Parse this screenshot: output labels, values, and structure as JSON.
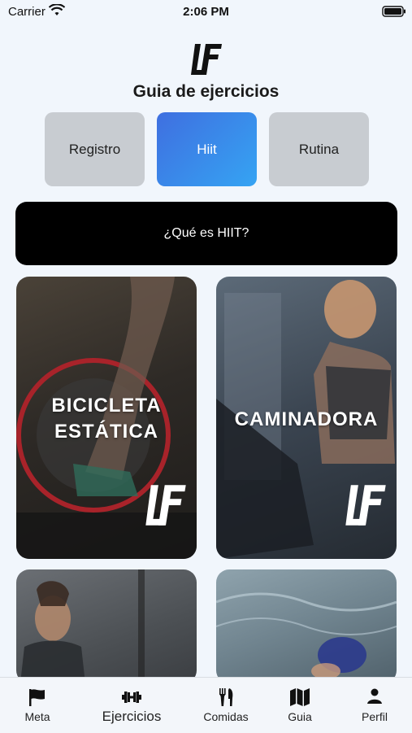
{
  "status": {
    "carrier": "Carrier",
    "time": "2:06 PM"
  },
  "header": {
    "title": "Guia de ejercicios"
  },
  "segments": [
    {
      "label": "Registro"
    },
    {
      "label": "Hiit"
    },
    {
      "label": "Rutina"
    }
  ],
  "info_button": {
    "label": "¿Qué es HIIT?"
  },
  "cards": [
    {
      "label": "BICICLETA\nESTÁTICA"
    },
    {
      "label": "CAMINADORA"
    }
  ],
  "tabs": [
    {
      "label": "Meta",
      "icon": "flag-icon"
    },
    {
      "label": "Ejercicios",
      "icon": "dumbbell-icon"
    },
    {
      "label": "Comidas",
      "icon": "utensils-icon"
    },
    {
      "label": "Guia",
      "icon": "map-icon"
    },
    {
      "label": "Perfil",
      "icon": "person-icon"
    }
  ],
  "colors": {
    "accent_start": "#3f6fe0",
    "accent_end": "#35a4f3",
    "inactive_segment": "#c8ccd1"
  }
}
